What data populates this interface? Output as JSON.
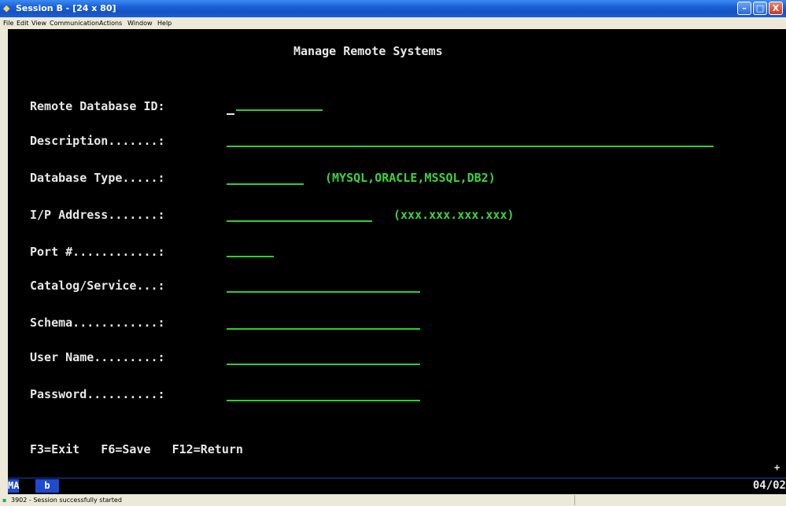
{
  "window": {
    "title": "Session B - [24 x 80]",
    "title_icon": "terminal-session-icon",
    "minimize": "–",
    "maximize": "□",
    "close": "X"
  },
  "menu": [
    "File",
    "Edit",
    "View",
    "Communication",
    "Actions",
    "Window",
    "Help"
  ],
  "screen": {
    "heading": "Manage Remote Systems",
    "fields": [
      {
        "label": "Remote Database ID:",
        "value": "",
        "hint": ""
      },
      {
        "label": "Description.......:",
        "value": "",
        "hint": ""
      },
      {
        "label": "Database Type.....:",
        "value": "",
        "hint": "(MYSQL,ORACLE,MSSQL,DB2)"
      },
      {
        "label": "I/P Address.......:",
        "value": "",
        "hint": "(xxx.xxx.xxx.xxx)"
      },
      {
        "label": "Port #............:",
        "value": "",
        "hint": ""
      },
      {
        "label": "Catalog/Service...:",
        "value": "",
        "hint": ""
      },
      {
        "label": "Schema............:",
        "value": "",
        "hint": ""
      },
      {
        "label": "User Name.........:",
        "value": "",
        "hint": ""
      },
      {
        "label": "Password..........:",
        "value": "",
        "hint": ""
      }
    ],
    "function_keys": "F3=Exit   F6=Save   F12=Return",
    "cursor_marker": "+"
  },
  "oia": {
    "mode": "MA",
    "indicator": "b",
    "date": "04/02"
  },
  "statusbar": {
    "icon": "session-status-icon",
    "text": "3902 - Session successfully started"
  },
  "colors": {
    "background": "#000000",
    "label_text": "#e8e8e8",
    "input_field": "#2fcf2f",
    "hint_text": "#3cd33c",
    "titlebar": "#1552c4"
  }
}
